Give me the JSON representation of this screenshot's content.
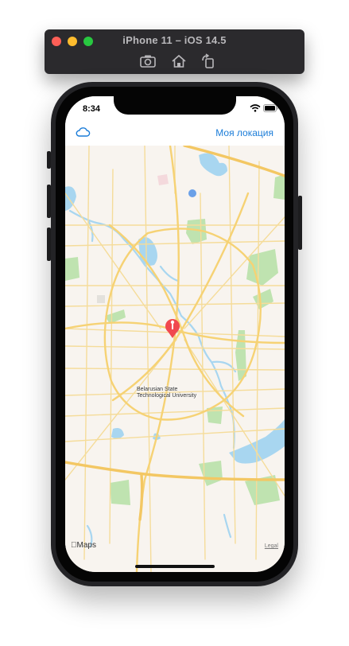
{
  "simulator": {
    "title": "iPhone 11 – iOS 14.5",
    "toolbar_icons": [
      "screenshot-icon",
      "home-icon",
      "rotate-icon"
    ]
  },
  "status_bar": {
    "time": "8:34",
    "icons": [
      "wifi-icon",
      "battery-icon"
    ]
  },
  "nav": {
    "left_icon": "cloud-icon",
    "right_button": "Моя локация",
    "accent": "#1a7cd8"
  },
  "map": {
    "pin_title_line1": "Belarusian State",
    "pin_title_line2": "Technological University",
    "pin_color": "#f0484f",
    "attribution": "Maps",
    "legal": "Legal"
  }
}
